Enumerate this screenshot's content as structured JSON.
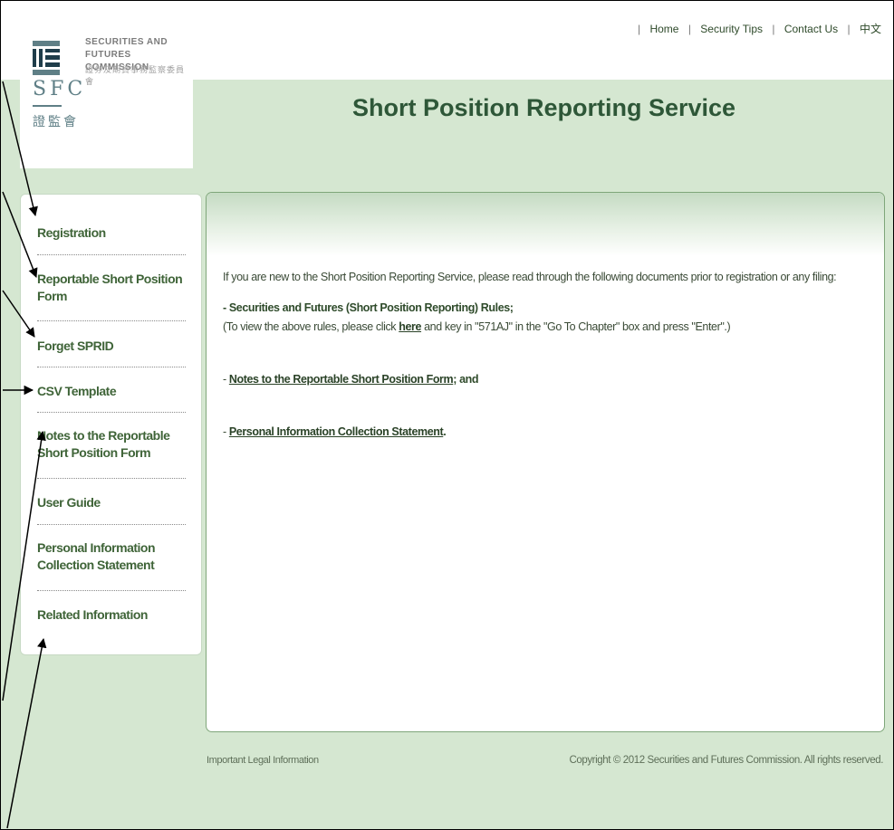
{
  "header": {
    "logo": {
      "en_line1": "SECURITIES AND",
      "en_line2": "FUTURES COMMISSION",
      "cn_small": "證券及期貨事務監察委員會",
      "abbr": "SFC",
      "cn_abbr": "證監會",
      "brand_color": "#5f7f86"
    },
    "links": [
      {
        "label": "Home"
      },
      {
        "label": "Security Tips"
      },
      {
        "label": "Contact Us"
      },
      {
        "label": "中文"
      }
    ]
  },
  "page_title": "Short Position Reporting Service",
  "sidebar": {
    "items": [
      {
        "label": "Registration"
      },
      {
        "label": "Reportable Short Position Form"
      },
      {
        "label": "Forget SPRID"
      },
      {
        "label": "CSV Template"
      },
      {
        "label": "Notes to the Reportable Short Position Form"
      },
      {
        "label": "User Guide"
      },
      {
        "label": "Personal Information Collection Statement"
      },
      {
        "label": "Related Information"
      }
    ]
  },
  "content": {
    "intro": "If you are new to the Short Position Reporting Service, please read through the following documents prior to registration or any filing:",
    "rules_title": "- Securities and Futures (Short Position Reporting) Rules;",
    "rules_note_pre": "(To view the above rules, please click ",
    "rules_note_link": "here",
    "rules_note_post": " and key in \"571AJ\" in the \"Go To Chapter\" box and press \"Enter\".)",
    "notes_prefix": "- ",
    "notes_link": "Notes to the Reportable Short Position Form",
    "notes_suffix": "; and",
    "pics_prefix": "- ",
    "pics_link": "Personal Information Collection Statement",
    "pics_suffix": "."
  },
  "footer": {
    "legal": "Important Legal Information",
    "copyright": "Copyright © 2012 Securities and Futures Commission. All rights reserved."
  },
  "colors": {
    "background": "#d5e7d1",
    "title": "#2e5738",
    "sidebar_text": "#3f6438"
  }
}
